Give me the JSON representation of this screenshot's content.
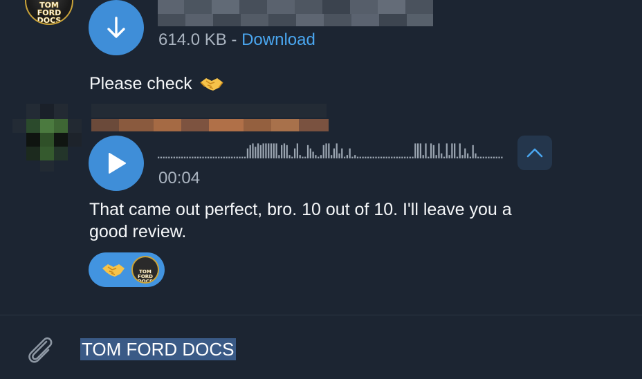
{
  "previous_message": {
    "sender_avatar_text": "TOM FORD DOCS",
    "file": {
      "size_text": "614.0 KB",
      "separator": " - ",
      "download_label": "Download"
    },
    "caption": "Please check",
    "caption_emoji": "handshake-emoji"
  },
  "voice_message": {
    "duration": "00:04",
    "text_line1": "That came out perfect, bro. 10 out of 10. I'll leave you a",
    "text_line2": "good review.",
    "reaction": {
      "emoji": "handshake-emoji",
      "reactor_avatar_text": "TOM FORD DOCS"
    }
  },
  "composer": {
    "draft_text": "TOM FORD DOCS",
    "attach_icon": "paperclip-icon"
  },
  "colors": {
    "background": "#1c2532",
    "accent": "#3f8ed8",
    "link": "#4aa6ef",
    "selection": "#3a5a86"
  }
}
